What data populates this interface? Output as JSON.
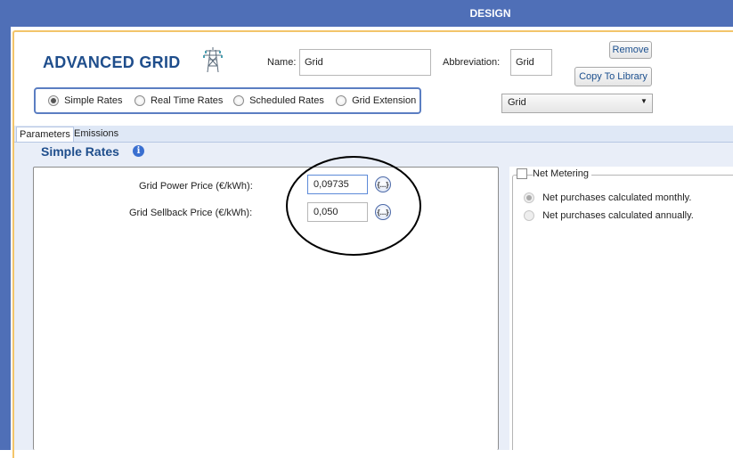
{
  "window": {
    "title": "DESIGN"
  },
  "header": {
    "title": "ADVANCED GRID",
    "name_label": "Name:",
    "name_value": "Grid",
    "abbreviation_label": "Abbreviation:",
    "abbreviation_value": "Grid",
    "remove_label": "Remove",
    "copy_label": "Copy To Library"
  },
  "rate_types": [
    {
      "label": "Simple Rates",
      "selected": true
    },
    {
      "label": "Real Time Rates",
      "selected": false
    },
    {
      "label": "Scheduled Rates",
      "selected": false
    },
    {
      "label": "Grid Extension",
      "selected": false
    }
  ],
  "grid_select": {
    "value": "Grid"
  },
  "tabs": [
    {
      "label": "Parameters",
      "active": true
    },
    {
      "label": "Emissions",
      "active": false
    }
  ],
  "simple_rates": {
    "title": "Simple Rates",
    "power_price_label": "Grid Power Price (€/kWh):",
    "power_price_value": "0,09735",
    "sellback_price_label": "Grid Sellback Price (€/kWh):",
    "sellback_price_value": "0,050",
    "sensitivity_icon": "{...}"
  },
  "net_metering": {
    "label": "Net Metering",
    "checked": false,
    "options": [
      {
        "label": "Net purchases calculated monthly.",
        "selected": true
      },
      {
        "label": "Net purchases calculated annually.",
        "selected": false
      }
    ]
  },
  "icons": {
    "grid": "transmission-tower-icon",
    "info": "info-icon",
    "dropdown": "chevron-down-icon"
  },
  "colors": {
    "titlebar": "#4f6fb7",
    "accent_frame": "#f3c56a",
    "heading": "#1f4e8c",
    "annotation": "#000000"
  }
}
